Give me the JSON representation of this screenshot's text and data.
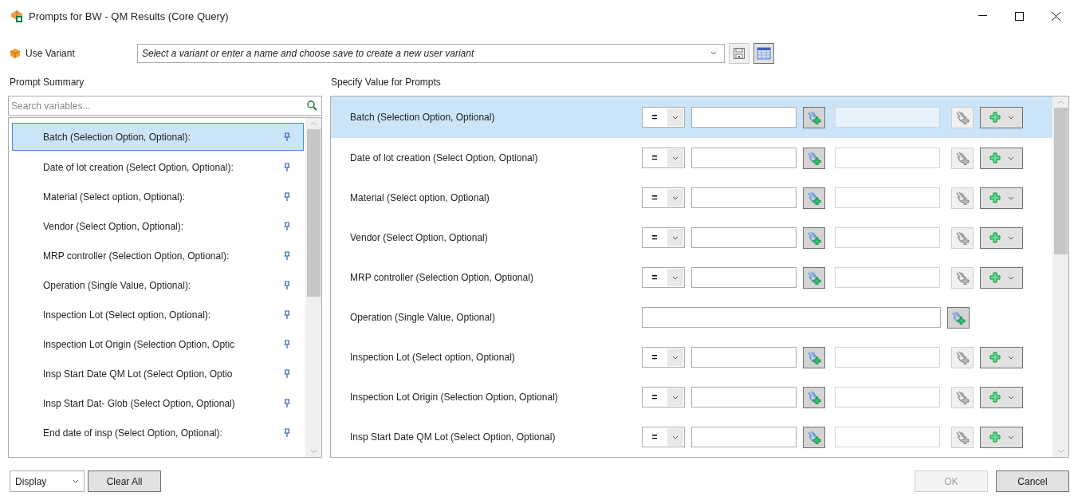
{
  "window": {
    "title": "Prompts for BW - QM Results (Core Query)"
  },
  "variant": {
    "label": "Use Variant",
    "placeholder": "Select a variant or enter a name and choose save to create a new user variant"
  },
  "summary": {
    "title": "Prompt Summary",
    "search_placeholder": "Search variables...",
    "items": [
      {
        "label": "Batch (Selection Option, Optional):",
        "selected": true
      },
      {
        "label": "Date of lot creation (Select Option, Optional):",
        "selected": false
      },
      {
        "label": "Material (Select option, Optional):",
        "selected": false
      },
      {
        "label": "Vendor (Select Option, Optional):",
        "selected": false
      },
      {
        "label": "MRP controller (Selection Option, Optional):",
        "selected": false
      },
      {
        "label": "Operation (Single Value, Optional):",
        "selected": false
      },
      {
        "label": "Inspection Lot (Select option, Optional):",
        "selected": false
      },
      {
        "label": "Inspection Lot Origin (Selection Option, Optic",
        "selected": false
      },
      {
        "label": "Insp Start Date QM Lot (Select Option, Optio",
        "selected": false
      },
      {
        "label": "Insp Start Dat- Glob (Select Option, Optional)",
        "selected": false
      },
      {
        "label": "End date of insp (Select Option, Optional):",
        "selected": false
      }
    ]
  },
  "prompts": {
    "title": "Specify Value for Prompts",
    "rows": [
      {
        "label": "Batch (Selection Option, Optional)",
        "kind": "range",
        "operator": "=",
        "selected": true
      },
      {
        "label": "Date of lot creation (Select Option, Optional)",
        "kind": "range",
        "operator": "=",
        "selected": false
      },
      {
        "label": "Material (Select option, Optional)",
        "kind": "range",
        "operator": "=",
        "selected": false
      },
      {
        "label": "Vendor (Select Option, Optional)",
        "kind": "range",
        "operator": "=",
        "selected": false
      },
      {
        "label": "MRP controller (Selection Option, Optional)",
        "kind": "range",
        "operator": "=",
        "selected": false
      },
      {
        "label": "Operation (Single Value, Optional)",
        "kind": "single",
        "selected": false
      },
      {
        "label": "Inspection Lot (Select option, Optional)",
        "kind": "range",
        "operator": "=",
        "selected": false
      },
      {
        "label": "Inspection Lot Origin (Selection Option, Optional)",
        "kind": "range",
        "operator": "=",
        "selected": false
      },
      {
        "label": "Insp Start Date QM Lot (Select Option, Optional)",
        "kind": "range",
        "operator": "=",
        "selected": false
      }
    ]
  },
  "footer": {
    "display": "Display",
    "clear": "Clear All",
    "ok": {
      "label": "OK",
      "disabled": true
    },
    "cancel": "Cancel"
  }
}
